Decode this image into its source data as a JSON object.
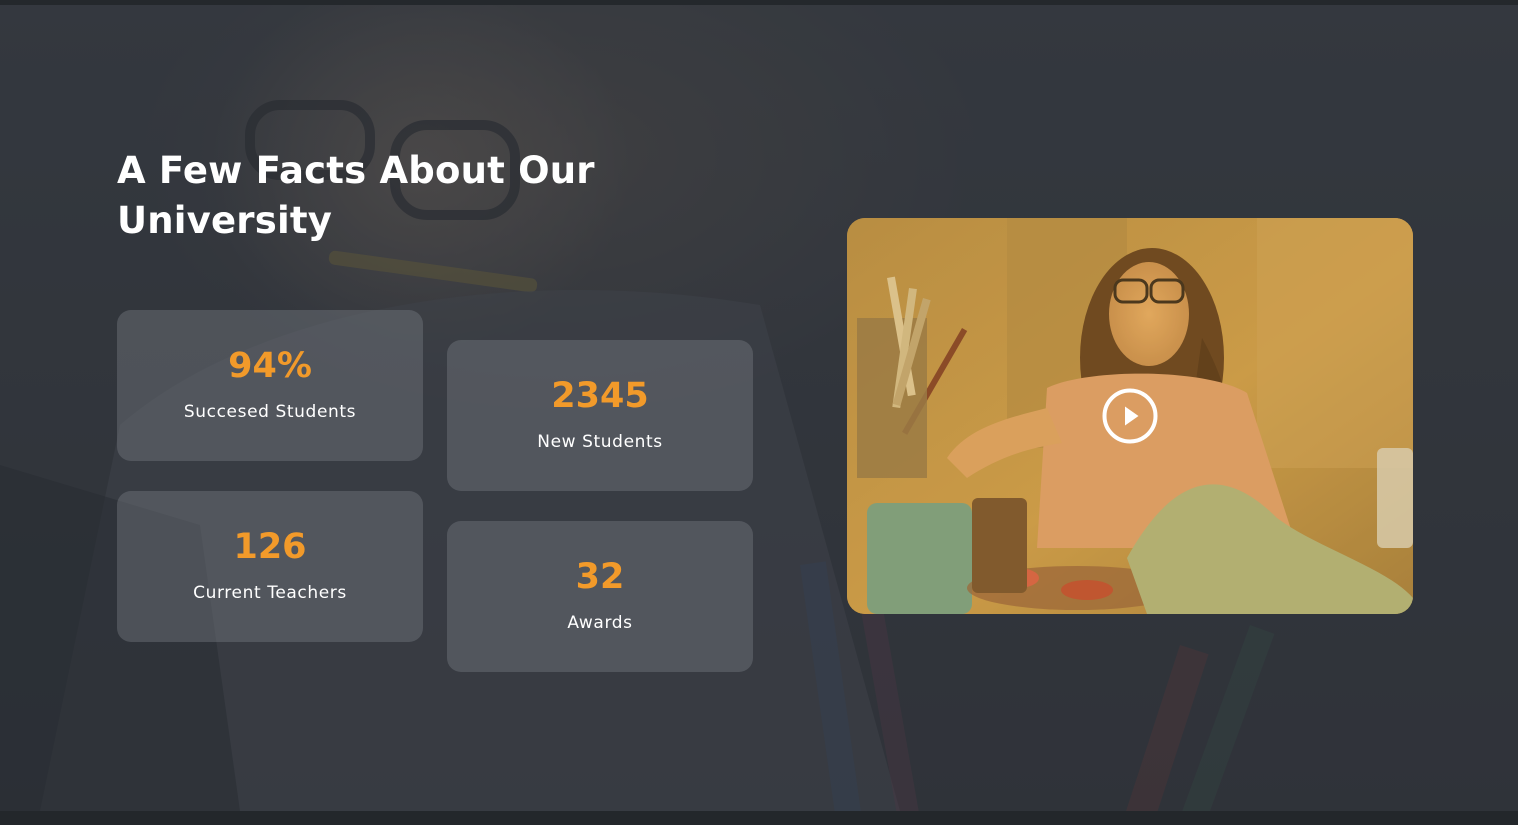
{
  "section": {
    "heading": "A Few Facts About Our University"
  },
  "stats": [
    {
      "value": "94%",
      "label": "Succesed Students"
    },
    {
      "value": "2345",
      "label": "New Students"
    },
    {
      "value": "126",
      "label": "Current Teachers"
    },
    {
      "value": "32",
      "label": "Awards"
    }
  ],
  "video": {
    "icon": "play-icon"
  },
  "colors": {
    "accent": "#f29a2a",
    "heading": "#ffffff",
    "card_background": "#5c6066",
    "section_background": "#3b3f45"
  }
}
